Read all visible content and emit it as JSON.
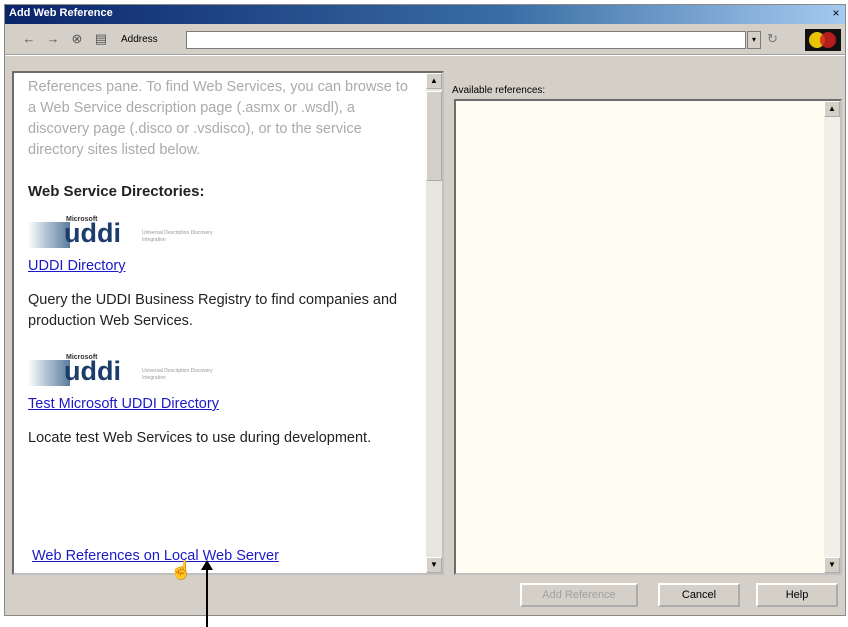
{
  "window": {
    "title": "Add Web Reference",
    "close_glyph": "×"
  },
  "toolbar": {
    "back_glyph": "←",
    "forward_glyph": "→",
    "stop_glyph": "⊗",
    "home_glyph": "▤",
    "address_label": "Address",
    "address_value": "",
    "dropdown_glyph": "▾",
    "go_glyph": "↻"
  },
  "left_pane": {
    "intro_text": "References pane. To find Web Services, you can browse to a Web Service description page (.asmx or .wsdl), a discovery page (.disco or .vsdisco), or to the service directory sites listed below.",
    "directories_heading": "Web Service Directories:",
    "uddi_logo": {
      "ms_text": "Microsoft",
      "word": "uddi",
      "tagline": "Universal Description Discovery Integration"
    },
    "entries": [
      {
        "link": "UDDI Directory",
        "description": "Query the UDDI Business Registry to find companies and production Web Services."
      },
      {
        "link": "Test Microsoft UDDI Directory",
        "description": "Locate test Web Services to use during development."
      }
    ],
    "local_link": "Web References on Local Web Server",
    "scroll_up_glyph": "▲",
    "scroll_down_glyph": "▼"
  },
  "right_pane": {
    "label": "Available references:"
  },
  "buttons": {
    "add_reference": "Add Reference",
    "cancel": "Cancel",
    "help": "Help"
  },
  "cursor_glyph": "☝"
}
